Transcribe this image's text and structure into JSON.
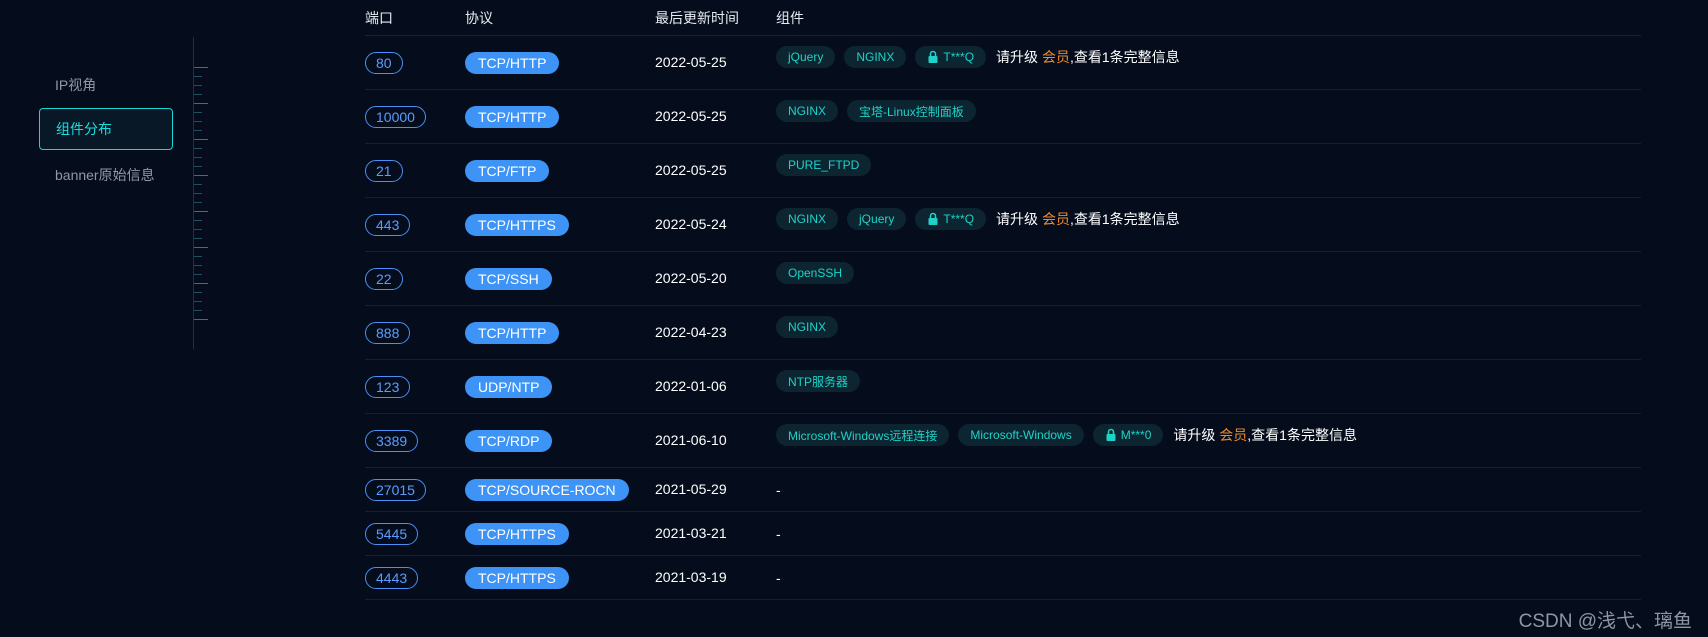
{
  "sidebar": {
    "items": [
      {
        "label": "IP视角",
        "active": false
      },
      {
        "label": "组件分布",
        "active": true
      },
      {
        "label": "banner原始信息",
        "active": false
      }
    ]
  },
  "table": {
    "headers": {
      "port": "端口",
      "protocol": "协议",
      "updated": "最后更新时间",
      "components": "组件"
    },
    "rows": [
      {
        "port": "80",
        "protocol": "TCP/HTTP",
        "date": "2022-05-25",
        "tags": [
          "jQuery",
          "NGINX"
        ],
        "locked": "T***Q",
        "upgrade": {
          "prefix": "请升级 ",
          "member": "会员",
          "suffix": ",查看1条完整信息"
        }
      },
      {
        "port": "10000",
        "protocol": "TCP/HTTP",
        "date": "2022-05-25",
        "tags": [
          "NGINX",
          "宝塔-Linux控制面板"
        ]
      },
      {
        "port": "21",
        "protocol": "TCP/FTP",
        "date": "2022-05-25",
        "tags": [
          "PURE_FTPD"
        ]
      },
      {
        "port": "443",
        "protocol": "TCP/HTTPS",
        "date": "2022-05-24",
        "tags": [
          "NGINX",
          "jQuery"
        ],
        "locked": "T***Q",
        "upgrade": {
          "prefix": "请升级 ",
          "member": "会员",
          "suffix": ",查看1条完整信息"
        }
      },
      {
        "port": "22",
        "protocol": "TCP/SSH",
        "date": "2022-05-20",
        "tags": [
          "OpenSSH"
        ]
      },
      {
        "port": "888",
        "protocol": "TCP/HTTP",
        "date": "2022-04-23",
        "tags": [
          "NGINX"
        ]
      },
      {
        "port": "123",
        "protocol": "UDP/NTP",
        "date": "2022-01-06",
        "tags": [
          "NTP服务器"
        ]
      },
      {
        "port": "3389",
        "protocol": "TCP/RDP",
        "date": "2021-06-10",
        "tags": [
          "Microsoft-Windows远程连接",
          "Microsoft-Windows"
        ],
        "locked": "M***0",
        "upgrade": {
          "prefix": "请升级 ",
          "member": "会员",
          "suffix": ",查看1条完整信息"
        }
      },
      {
        "port": "27015",
        "protocol": "TCP/SOURCE-ROCN",
        "date": "2021-05-29",
        "dash": "-"
      },
      {
        "port": "5445",
        "protocol": "TCP/HTTPS",
        "date": "2021-03-21",
        "dash": "-"
      },
      {
        "port": "4443",
        "protocol": "TCP/HTTPS",
        "date": "2021-03-19",
        "dash": "-"
      }
    ]
  },
  "watermark": "CSDN @浅弋、璃鱼",
  "colors": {
    "accent": "#19e0e0",
    "protocol_badge": "#3d94f6",
    "port_border": "#4b8ff5",
    "member": "#f0892d",
    "background": "#050d1c"
  }
}
